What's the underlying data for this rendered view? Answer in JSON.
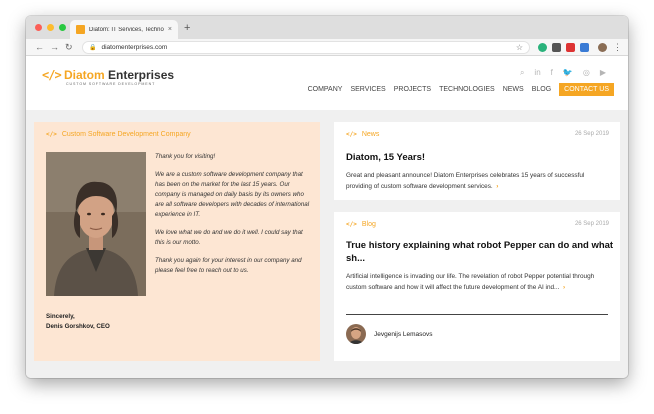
{
  "browser": {
    "tab_title": "Diatom: IT Services, Technolog",
    "tab_close": "×",
    "new_tab": "+",
    "url": "diatomenterprises.com",
    "back": "←",
    "forward": "→",
    "reload": "↻",
    "lock": "🔒",
    "star": "☆",
    "menu": "⋮"
  },
  "site": {
    "logo_mark": "</>",
    "logo_name_a": "Diatom",
    "logo_name_b": " Enterprises",
    "logo_sub": "CUSTOM SOFTWARE DEVELOPMENT",
    "social": [
      "⌕",
      "in",
      "f",
      "🐦",
      "◎",
      "▶"
    ],
    "nav": [
      "COMPANY",
      "SERVICES",
      "PROJECTS",
      "TECHNOLOGIES",
      "NEWS",
      "BLOG"
    ],
    "contact": "CONTACT US"
  },
  "intro": {
    "code_icon": "</>",
    "heading": "Custom Software Development Company",
    "paragraphs": [
      "Thank you for visiting!",
      "We are a custom software development company that has been on the market for the last 15 years. Our company is managed on daily basis by its owners who are all software developers with decades of international experience in IT.",
      "We love what we do and we do it well. I could say that this is our motto.",
      "Thank you again for your interest in our company and please feel free to reach out to us."
    ],
    "signoff_1": "Sincerely,",
    "signoff_2": "Denis Gorshkov, CEO"
  },
  "news": {
    "code_icon": "</>",
    "label": "News",
    "date": "26 Sep 2019",
    "title": "Diatom, 15 Years!",
    "text": "Great and pleasant announce! Diatom Enterprises celebrates 15 years of successful providing of custom software development services.",
    "more": "›"
  },
  "blog": {
    "code_icon": "</>",
    "label": "Blog",
    "date": "26 Sep 2019",
    "title": "True history explaining what robot Pepper can do and what sh...",
    "text": "Artificial intelligence is invading our life. The revelation of robot Pepper potential through custom software and how it will affect the future development of the AI ind...",
    "more": "›",
    "author": "Jevgenijs Lemasovs"
  },
  "colors": {
    "accent": "#f5a623",
    "intro_bg": "#fde6d3",
    "content_bg": "#f0f0f0"
  }
}
